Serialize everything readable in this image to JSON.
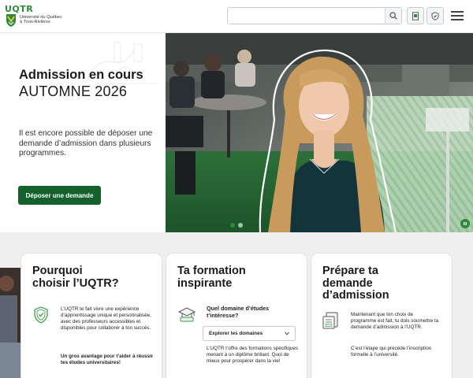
{
  "header": {
    "logo_word": "UQTR",
    "logo_university_line1": "Université du Québec",
    "logo_university_line2": "à Trois-Rivières",
    "search_placeholder": "",
    "icons": [
      "search-icon",
      "document-icon",
      "shield-icon",
      "hamburger-menu-icon"
    ]
  },
  "hero": {
    "title": "Admission en cours",
    "subtitle": "AUTOMNE 2026",
    "text": "Il est encore possible de déposer une demande d’admission dans plusieurs programmes.",
    "cta_label": "Déposer une demande",
    "slide_count": 2,
    "active_slide": 1
  },
  "cards": {
    "why": {
      "title_line1": "Pourquoi",
      "title_line2": "choisir l’UQTR?",
      "text": "L’UQTR te fait vivre une expérience d’apprentissage unique et personnalisée, avec des professeurs accessibles et disponibles pour collaborer à ton succès.",
      "strong": "Un gros avantage pour t’aider à réussir tes études universitaires!",
      "icon": "shield-icon"
    },
    "formation": {
      "title_line1": "Ta formation",
      "title_line2": "inspirante",
      "question": "Quel domaine d’études t’intéresse?",
      "select_label": "Explorer les domaines",
      "text": "L’UQTR t’offre des formations spécifiques menant à un diplôme brillant. Quoi de mieux pour prospérer dans la vie!",
      "icon": "graduation-cap-icon"
    },
    "prepare": {
      "title_line1": "Prépare ta",
      "title_line2": "demande",
      "title_line3": "d’admission",
      "text1": "Maintenant que ton choix de programme est fait, tu dois soumettre ta demande d’admission à l’UQTR.",
      "text2": "C’est l’étape qui précède l’inscription formelle à l’université.",
      "icon": "document-form-icon"
    }
  },
  "colors": {
    "brand_green": "#13612c",
    "accent_green": "#2f8a3c",
    "light_green": "#8fd19a"
  }
}
